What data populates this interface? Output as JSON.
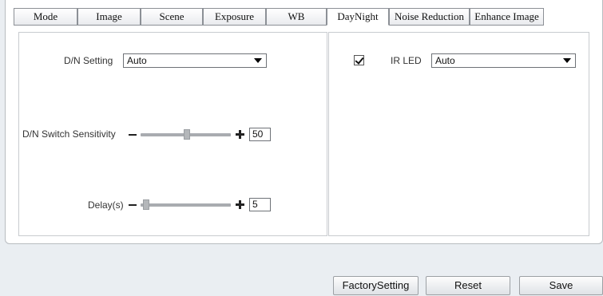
{
  "tabs": [
    "Mode",
    "Image",
    "Scene",
    "Exposure",
    "WB",
    "DayNight",
    "Noise Reduction",
    "Enhance Image"
  ],
  "active_tab": "DayNight",
  "left": {
    "dn_setting": {
      "label": "D/N Setting",
      "value": "Auto"
    },
    "sensitivity": {
      "label": "D/N Switch Sensitivity",
      "value": "50",
      "level_percent": 50
    },
    "delay": {
      "label": "Delay(s)",
      "value": "5",
      "level_percent": 5
    }
  },
  "right": {
    "ir_led": {
      "label": "IR LED",
      "checked": true,
      "value": "Auto"
    }
  },
  "buttons": {
    "factory": "FactorySetting",
    "reset": "Reset",
    "save": "Save"
  }
}
